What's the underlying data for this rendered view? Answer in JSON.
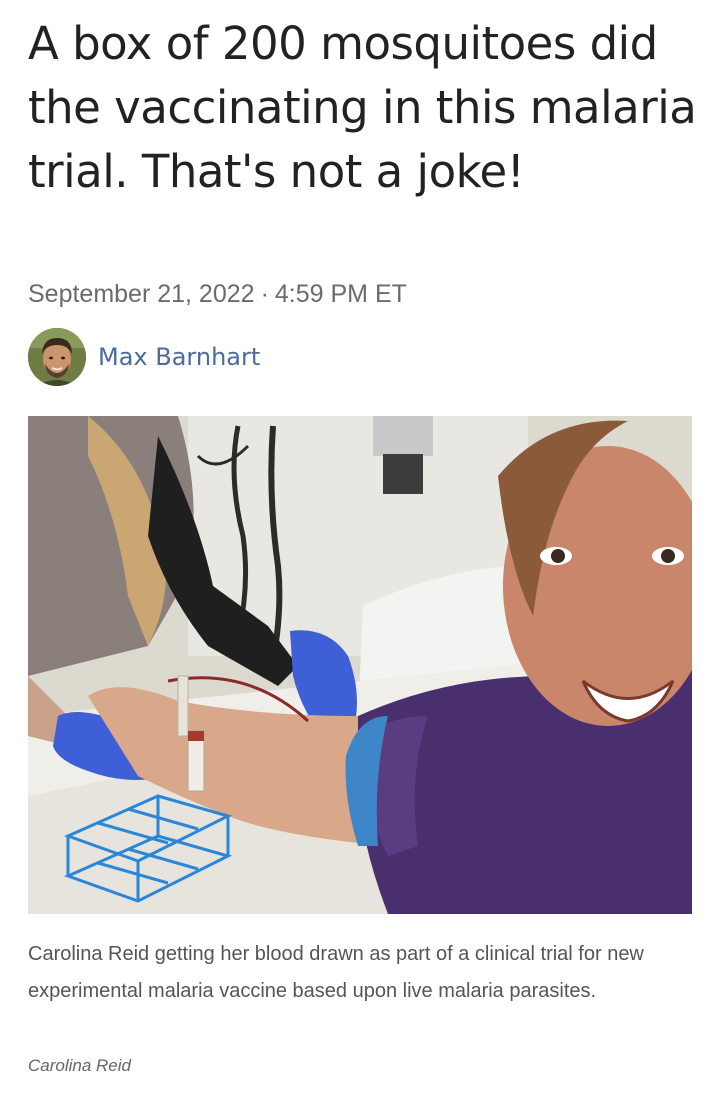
{
  "article": {
    "headline": "A box of 200 mosquitoes did the vaccinating in this malaria trial. That's not a joke!",
    "date": "September 21, 2022",
    "separator": "·",
    "time": "4:59 PM ET",
    "author": "Max Barnhart",
    "image": {
      "caption": "Carolina Reid getting her blood drawn as part of a clinical trial for new experimental malaria vaccine based upon live malaria parasites.",
      "credit": "Carolina Reid"
    }
  }
}
